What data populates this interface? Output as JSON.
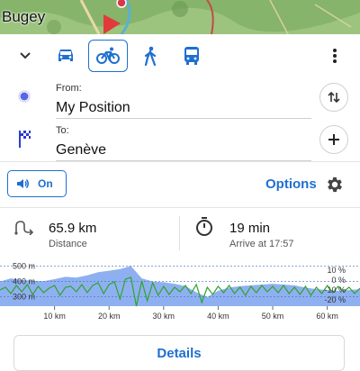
{
  "map": {
    "label": "Bugey"
  },
  "modes": [
    {
      "name": "car",
      "icon": "car-icon",
      "active": false
    },
    {
      "name": "bike",
      "icon": "bicycle-icon",
      "active": true
    },
    {
      "name": "walk",
      "icon": "walking-icon",
      "active": false
    },
    {
      "name": "transit",
      "icon": "bus-icon",
      "active": false
    }
  ],
  "route": {
    "from_label": "From:",
    "from_value": "My Position",
    "to_label": "To:",
    "to_value": "Genève"
  },
  "controls": {
    "voice_label": "On",
    "options_label": "Options"
  },
  "stats": {
    "distance_value": "65.9 km",
    "distance_label": "Distance",
    "duration_value": "19 min",
    "arrival_label": "Arrive at 17:57"
  },
  "chart_data": {
    "type": "area",
    "title": "",
    "x_ticks": [
      "10 km",
      "20 km",
      "30 km",
      "40 km",
      "50 km",
      "60 km"
    ],
    "x_tick_values": [
      10,
      20,
      30,
      40,
      50,
      60
    ],
    "xlim": [
      0,
      66
    ],
    "left_axis": {
      "ticks": [
        "500 m",
        "400 m",
        "300 m"
      ],
      "values": [
        500,
        400,
        300
      ],
      "ylim": [
        240,
        520
      ]
    },
    "right_axis": {
      "ticks": [
        "10 %",
        "0 %",
        "-10 %",
        "-20 %"
      ],
      "values": [
        10,
        0,
        -10,
        -20
      ]
    },
    "series": [
      {
        "type": "area",
        "unit": "m",
        "x": [
          0,
          2,
          4,
          6,
          8,
          10,
          12,
          14,
          16,
          18,
          20,
          22,
          24,
          26,
          28,
          30,
          32,
          34,
          36,
          38,
          40,
          42,
          44,
          46,
          48,
          50,
          52,
          54,
          56,
          58,
          60,
          62,
          64,
          66
        ],
        "values": [
          400,
          420,
          410,
          405,
          402,
          415,
          430,
          425,
          440,
          460,
          470,
          480,
          500,
          420,
          400,
          395,
          385,
          370,
          330,
          300,
          340,
          360,
          370,
          375,
          380,
          385,
          380,
          375,
          360,
          350,
          345,
          340,
          345,
          350
        ]
      },
      {
        "type": "line",
        "unit": "%",
        "x": [
          0,
          1,
          2,
          3,
          4,
          5,
          6,
          7,
          8,
          9,
          10,
          11,
          12,
          13,
          14,
          15,
          16,
          17,
          18,
          19,
          20,
          21,
          22,
          23,
          24,
          25,
          26,
          27,
          28,
          29,
          30,
          31,
          32,
          33,
          34,
          35,
          36,
          37,
          38,
          39,
          40,
          41,
          42,
          43,
          44,
          45,
          46,
          47,
          48,
          49,
          50,
          51,
          52,
          53,
          54,
          55,
          56,
          57,
          58,
          59,
          60,
          61,
          62,
          63,
          64,
          65,
          66
        ],
        "values": [
          0,
          3,
          -4,
          5,
          -2,
          6,
          -5,
          4,
          -3,
          2,
          5,
          -6,
          3,
          4,
          -2,
          6,
          -3,
          5,
          8,
          -4,
          6,
          9,
          -10,
          12,
          14,
          -18,
          10,
          -12,
          8,
          -6,
          4,
          -5,
          3,
          -2,
          5,
          -4,
          6,
          -14,
          3,
          -5,
          4,
          -3,
          5,
          -4,
          3,
          -6,
          4,
          -3,
          5,
          -2,
          4,
          -3,
          5,
          -4,
          3,
          -5,
          4,
          -6,
          3,
          -4,
          5,
          -3,
          4,
          -2,
          3,
          -4,
          2
        ]
      }
    ],
    "colors": {
      "area": "#8fb0f0",
      "line": "#2ca52c"
    }
  }
}
